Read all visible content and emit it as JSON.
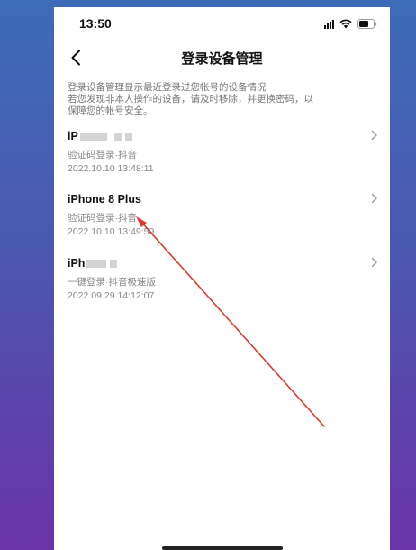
{
  "status_bar": {
    "time": "13:50",
    "icons": [
      "signal-icon",
      "wifi-icon",
      "battery-icon"
    ]
  },
  "nav": {
    "back_icon": "chevron-left-icon",
    "title": "登录设备管理"
  },
  "intro": {
    "line1": "登录设备管理显示最近登录过您帐号的设备情况",
    "line2": "若您发现非本人操作的设备，请及时移除，并更换密码，以",
    "line3": "保障您的帐号安全。"
  },
  "devices": [
    {
      "name": "iP",
      "name_redacted": true,
      "method": "验证码登录·抖音",
      "time": "2022.10.10 13:48:11"
    },
    {
      "name": "iPhone 8 Plus",
      "name_redacted": false,
      "method": "验证码登录·抖音",
      "time": "2022.10.10 13:49:59"
    },
    {
      "name": "iPh",
      "name_redacted": true,
      "method": "一键登录·抖音极速版",
      "time": "2022.09.29 14:12:07"
    }
  ],
  "colors": {
    "background_top": "#3d6bb8",
    "background_bottom": "#6a33a8",
    "annotation_arrow": "#d93a2b",
    "secondary_text": "#888888"
  }
}
